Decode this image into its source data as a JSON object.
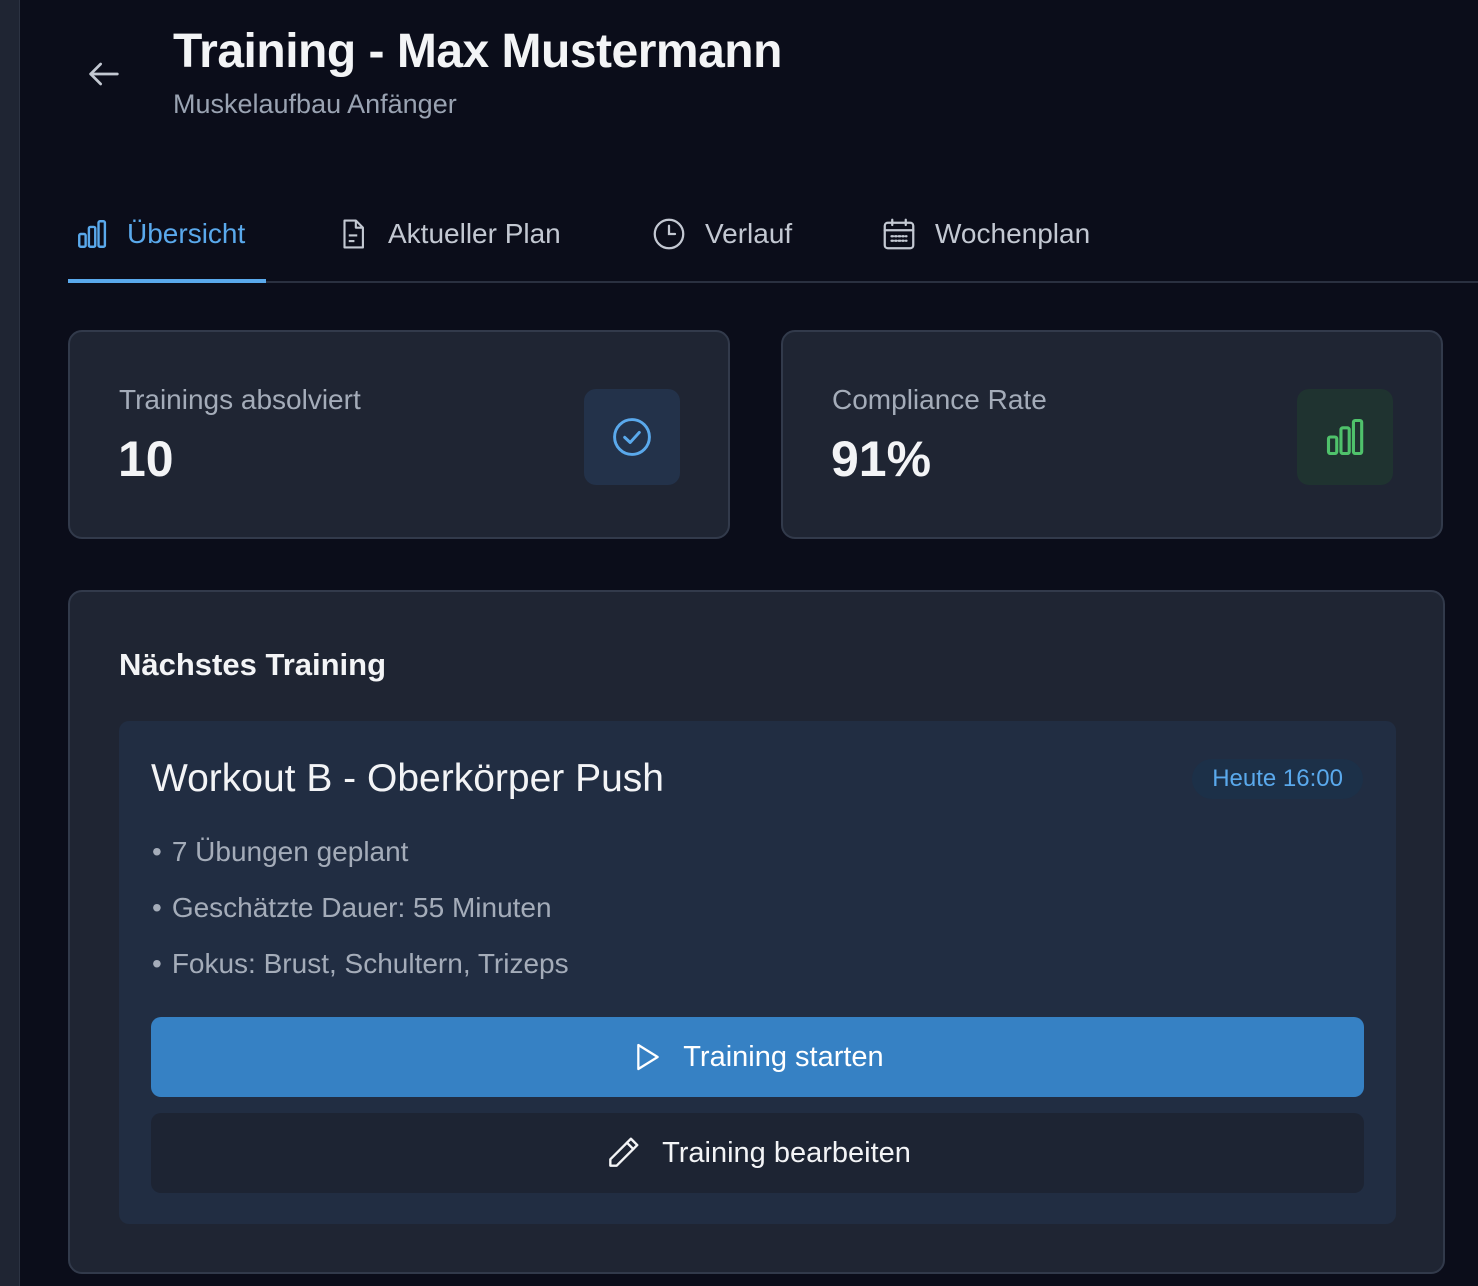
{
  "header": {
    "title": "Training - Max Mustermann",
    "subtitle": "Muskelaufbau Anfänger",
    "back_icon": "arrow-left-icon"
  },
  "tabs": [
    {
      "label": "Übersicht",
      "icon": "bar-chart-icon",
      "active": true
    },
    {
      "label": "Aktueller Plan",
      "icon": "document-icon",
      "active": false
    },
    {
      "label": "Verlauf",
      "icon": "clock-icon",
      "active": false
    },
    {
      "label": "Wochenplan",
      "icon": "calendar-icon",
      "active": false
    }
  ],
  "stats": [
    {
      "label": "Trainings absolviert",
      "value": "10",
      "icon": "check-circle-icon",
      "accent": "#5aa9ec"
    },
    {
      "label": "Compliance Rate",
      "value": "91%",
      "icon": "bar-chart-icon",
      "accent": "#4fc26b"
    }
  ],
  "next_training": {
    "heading": "Nächstes Training",
    "workout_title": "Workout B - Oberkörper Push",
    "badge": "Heute 16:00",
    "details": [
      "7 Übungen geplant",
      "Geschätzte Dauer: 55 Minuten",
      "Fokus: Brust, Schultern, Trizeps"
    ],
    "start_label": "Training starten",
    "start_icon": "play-icon",
    "edit_label": "Training bearbeiten",
    "edit_icon": "pencil-icon"
  },
  "colors": {
    "background": "#0b0d1a",
    "card": "#1f2533",
    "accent_blue": "#5aa9ec",
    "primary_button": "#3681c4",
    "accent_green": "#4fc26b"
  }
}
